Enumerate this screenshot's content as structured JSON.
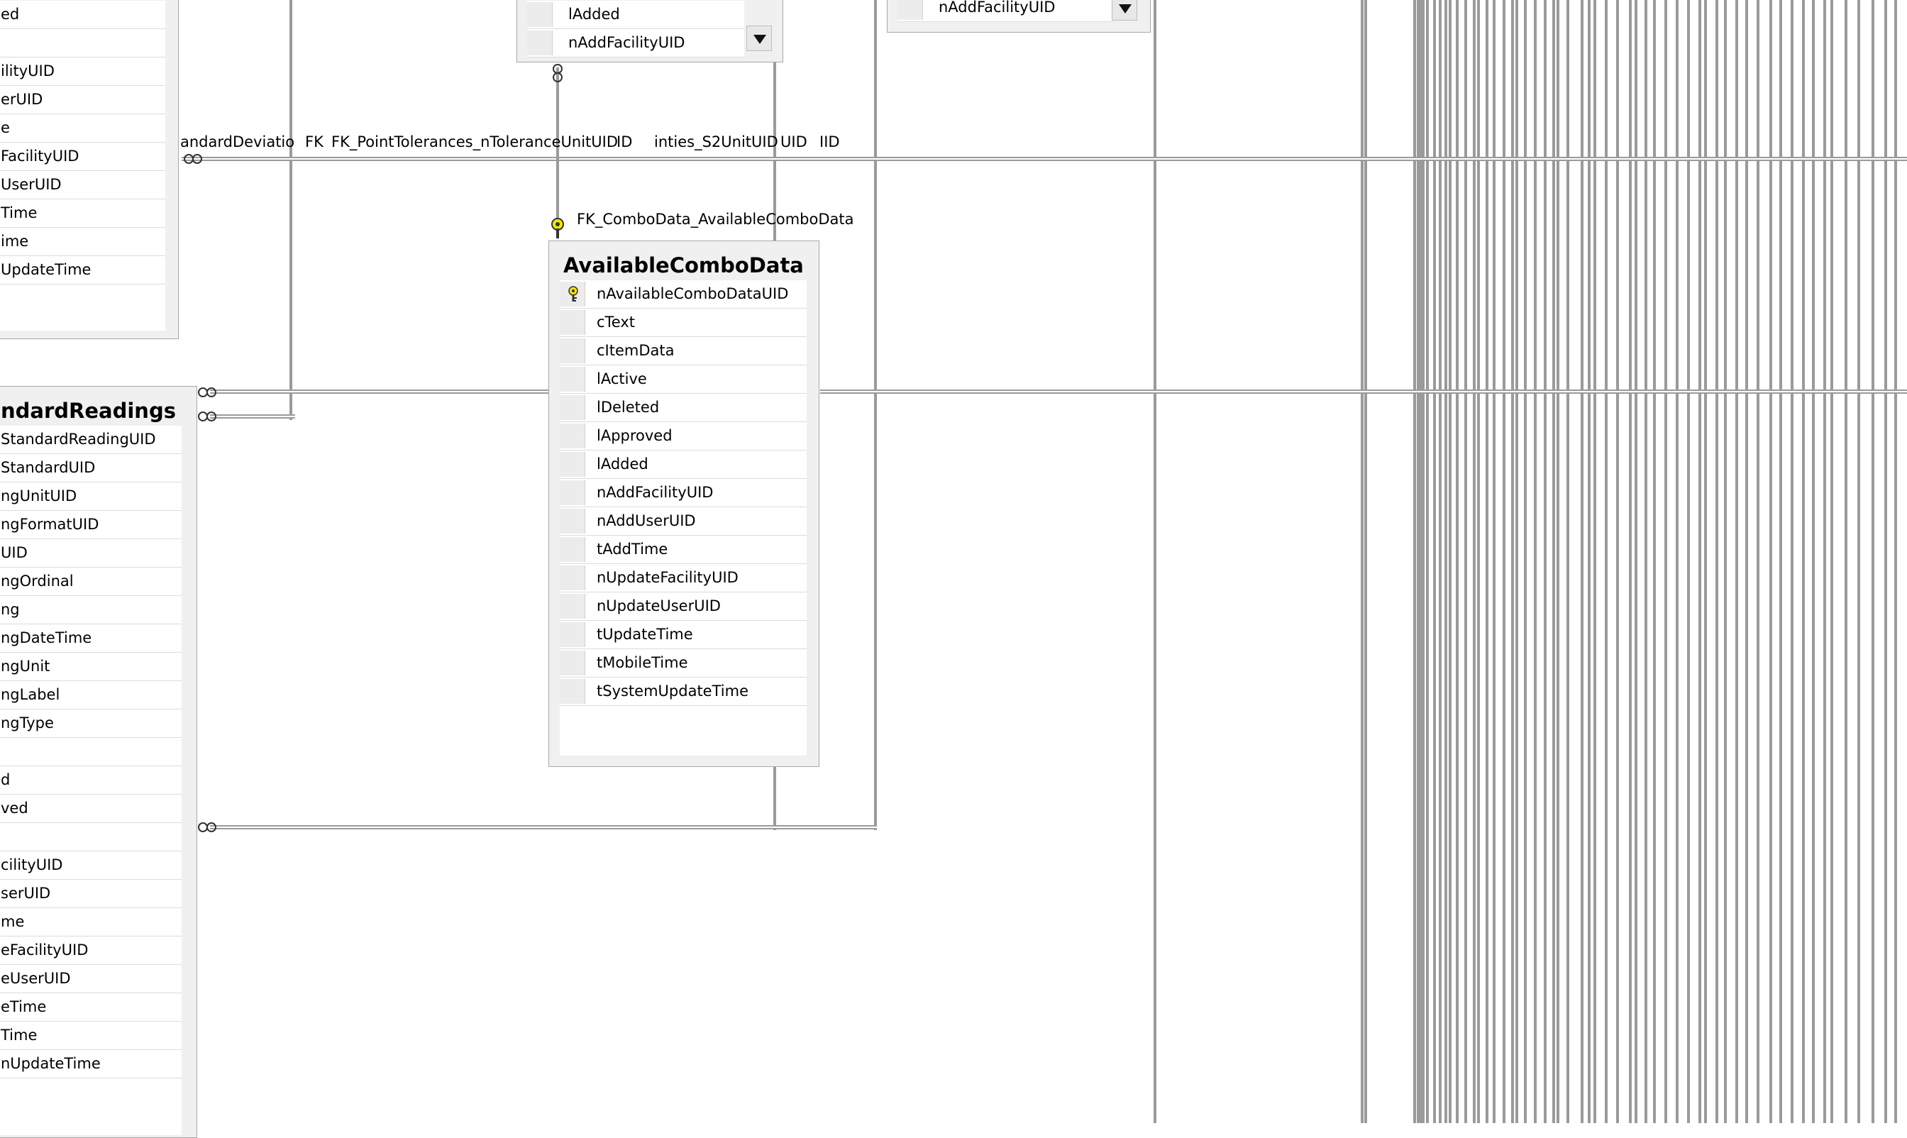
{
  "left_table_top": {
    "rows": [
      "ed",
      "",
      "ilityUID",
      "erUID",
      "e",
      "FacilityUID",
      "UserUID",
      "Time",
      "ime",
      "UpdateTime"
    ]
  },
  "top_table_mid": {
    "rows": [
      "lAdded",
      "nAddFacilityUID"
    ]
  },
  "top_table_right": {
    "rows": [
      "nAddFacilityUID"
    ]
  },
  "relationship_labels": {
    "std_deviation": "andardDeviatio",
    "fk_prefix": "FK",
    "fk_point_tolerances": "FK_PointTolerances_nToleranceUnitUID",
    "id_a": "ID",
    "s2unit": "inties_S2UnitUID",
    "uid": "UID",
    "iid": "IID",
    "fk_combo": "FK_ComboData_AvailableComboData"
  },
  "available_combo_data": {
    "title": "AvailableComboData",
    "columns": [
      {
        "name": "nAvailableComboDataUID",
        "primary_key": true
      },
      {
        "name": "cText"
      },
      {
        "name": "cItemData"
      },
      {
        "name": "lActive"
      },
      {
        "name": "lDeleted"
      },
      {
        "name": "lApproved"
      },
      {
        "name": "lAdded"
      },
      {
        "name": "nAddFacilityUID"
      },
      {
        "name": "nAddUserUID"
      },
      {
        "name": "tAddTime"
      },
      {
        "name": "nUpdateFacilityUID"
      },
      {
        "name": "nUpdateUserUID"
      },
      {
        "name": "tUpdateTime"
      },
      {
        "name": "tMobileTime"
      },
      {
        "name": "tSystemUpdateTime"
      }
    ]
  },
  "standard_readings": {
    "title": "ndardReadings",
    "rows": [
      "StandardReadingUID",
      "StandardUID",
      "ngUnitUID",
      "ngFormatUID",
      "UID",
      "ngOrdinal",
      "ng",
      "ngDateTime",
      "ngUnit",
      "ngLabel",
      "ngType",
      "",
      "d",
      "ved",
      "",
      "cilityUID",
      "serUID",
      "me",
      "eFacilityUID",
      "eUserUID",
      "eTime",
      "Time",
      "nUpdateTime"
    ]
  },
  "icons": {
    "primary_key": "key-icon",
    "relationship_end": "infinity-icon",
    "scroll_down": "triangle-down-icon"
  },
  "colors": {
    "key_fill": "#f2e600",
    "connector": "#9a9a9a",
    "table_bg": "#f0f0f0"
  }
}
